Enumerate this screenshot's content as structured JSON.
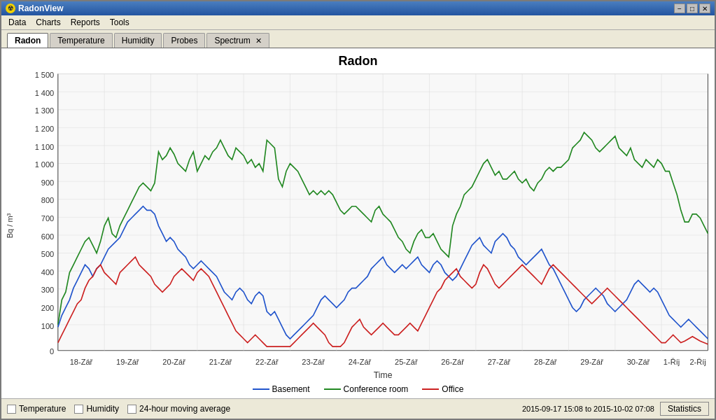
{
  "window": {
    "title": "RadonView",
    "minimize": "−",
    "maximize": "□",
    "close": "✕"
  },
  "menu": {
    "items": [
      "Data",
      "Charts",
      "Reports",
      "Tools"
    ]
  },
  "tabs": [
    {
      "label": "Radon",
      "active": true,
      "closable": false
    },
    {
      "label": "Temperature",
      "active": false,
      "closable": false
    },
    {
      "label": "Humidity",
      "active": false,
      "closable": false
    },
    {
      "label": "Probes",
      "active": false,
      "closable": false
    },
    {
      "label": "Spectrum",
      "active": false,
      "closable": true
    }
  ],
  "chart": {
    "title": "Radon",
    "y_axis_label": "Bq / m³",
    "x_axis_label": "Time",
    "y_ticks": [
      "1 500",
      "1 400",
      "1 300",
      "1 200",
      "1 100",
      "1 000",
      "900",
      "800",
      "700",
      "600",
      "500",
      "400",
      "300",
      "200",
      "100",
      "0"
    ],
    "x_ticks": [
      "18-Zář",
      "19-Zář",
      "20-Zář",
      "21-Zář",
      "22-Zář",
      "23-Zář",
      "24-Zář",
      "25-Zář",
      "26-Zář",
      "27-Zář",
      "28-Zář",
      "29-Zář",
      "30-Zář",
      "1-Říj",
      "2-Říj"
    ]
  },
  "legend": {
    "items": [
      {
        "label": "Basement",
        "color": "#2255cc"
      },
      {
        "label": "Conference room",
        "color": "#008800"
      },
      {
        "label": "Office",
        "color": "#cc2222"
      }
    ]
  },
  "bottom": {
    "checkboxes": [
      "Temperature",
      "Humidity",
      "24-hour moving average"
    ],
    "date_range": "2015-09-17 15:08 to 2015-10-02 07:08",
    "stats_button": "Statistics"
  }
}
